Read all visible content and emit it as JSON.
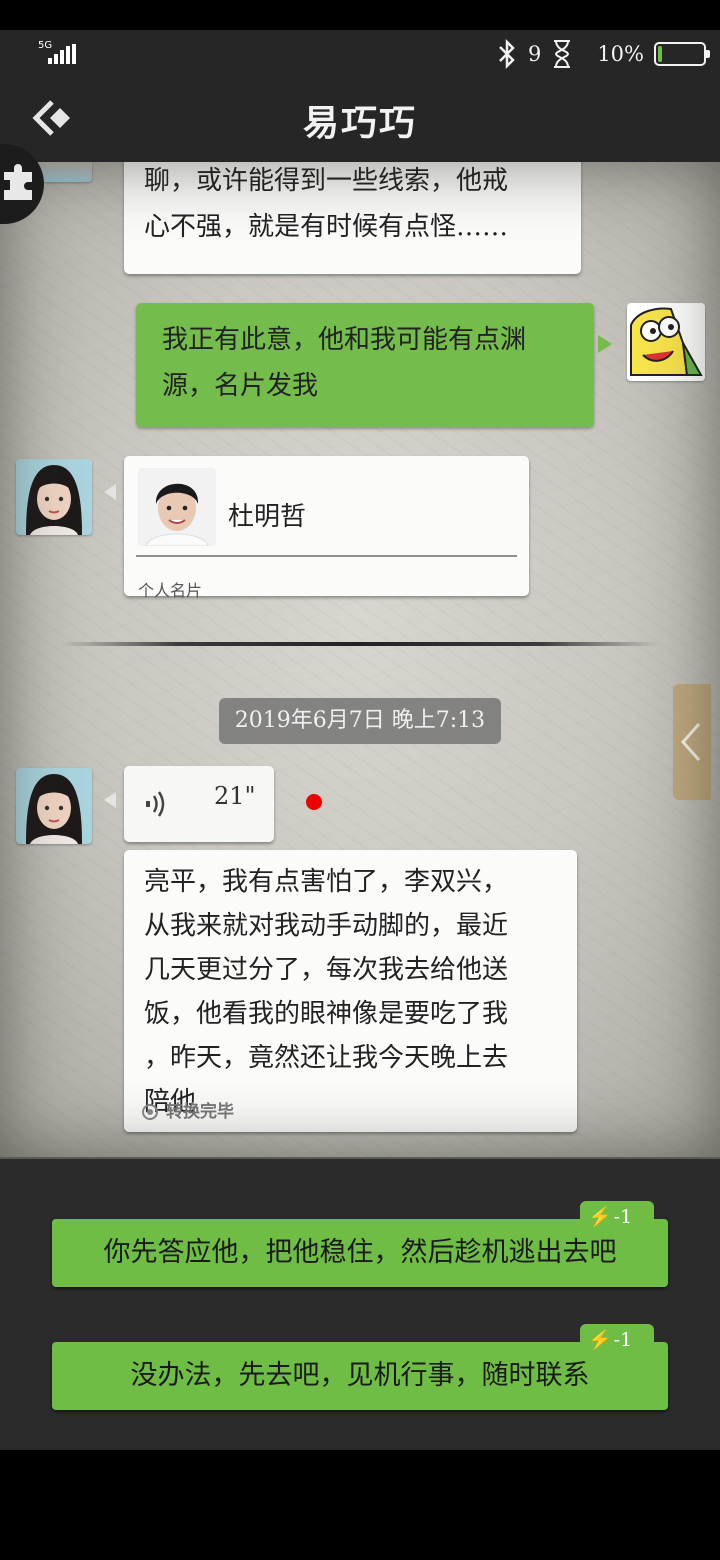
{
  "status_bar": {
    "network": "5G",
    "notification_count": "9",
    "battery_percent": "10%",
    "battery_level": 0.1
  },
  "header": {
    "title": "易巧巧"
  },
  "messages": {
    "partial_incoming": {
      "line1": "聊，或许能得到一些线索，他戒",
      "line2": "心不强，就是有时候有点怪……"
    },
    "outgoing": {
      "line1": "我正有此意，他和我可能有点渊",
      "line2": "源，名片发我"
    },
    "contact_card": {
      "name": "杜明哲",
      "type": "个人名片"
    },
    "timestamp": "2019年6月7日 晚上7:13",
    "voice": {
      "duration": "21\""
    },
    "transcript": {
      "lines": [
        "亮平，我有点害怕了，李双兴，",
        "从我来就对我动手动脚的，最近",
        "几天更过分了，每次我去给他送",
        "饭，他看我的眼神像是要吃了我",
        "，昨天，竟然还让我今天晚上去",
        "陪他"
      ],
      "status": "转换完毕"
    }
  },
  "reply_options": [
    {
      "text": "你先答应他，把他稳住，然后趁机逃出去吧",
      "cost": "-1"
    },
    {
      "text": "没办法，先去吧，见机行事，随时联系",
      "cost": "-1"
    }
  ],
  "colors": {
    "bubble_green": "#74bc4b",
    "option_green": "#6fbd45",
    "header_bg": "#262626",
    "unread_dot": "#e00000"
  }
}
